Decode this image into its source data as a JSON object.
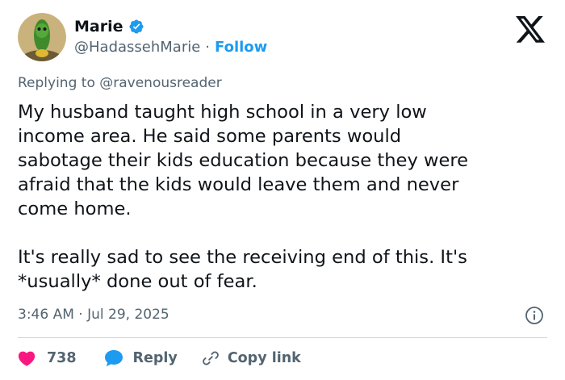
{
  "author": {
    "name": "Marie",
    "handle": "@HadassehMarie",
    "separator": "·",
    "follow_label": "Follow"
  },
  "reply_context": {
    "prefix": "Replying to ",
    "mention": "@ravenousreader"
  },
  "tweet": {
    "text": "My husband taught high school in a very low\nincome area. He said some parents would\nsabotage their kids education because they were\nafraid that the kids would leave them and never\ncome home.\n\nIt's really sad to see the receiving end of this. It's\n*usually* done out of fear."
  },
  "meta": {
    "timestamp": "3:46 AM · Jul 29, 2025"
  },
  "actions": {
    "like_count": "738",
    "reply_label": "Reply",
    "copy_link_label": "Copy link"
  },
  "colors": {
    "text": "#0f1419",
    "secondary": "#536471",
    "accent": "#1d9bf0",
    "like": "#f91880",
    "divider": "#cfd9de"
  },
  "icons": {
    "verified": "verified-badge-icon",
    "logo": "x-logo-icon",
    "info": "info-icon",
    "like": "heart-icon",
    "reply": "speech-bubble-icon",
    "link": "link-icon"
  }
}
